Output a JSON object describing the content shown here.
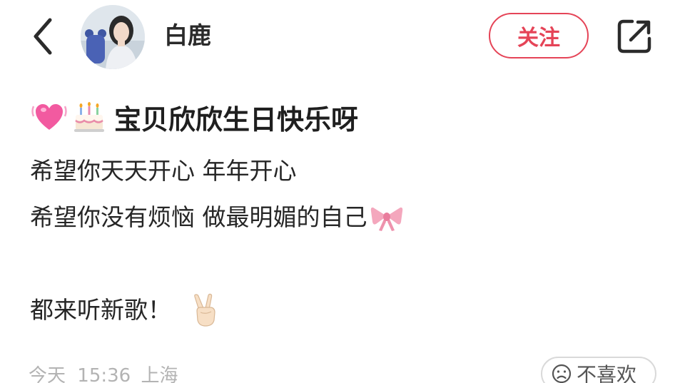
{
  "header": {
    "author_name": "白鹿",
    "follow_label": "关注"
  },
  "post": {
    "title": "宝贝欣欣生日快乐呀",
    "lines": [
      "希望你天天开心 年年开心",
      "希望你没有烦恼 做最明媚的自己",
      "都来听新歌！"
    ],
    "meta": {
      "date": "今天",
      "time": "15:36",
      "location": "上海"
    },
    "dislike_label": "不喜欢"
  },
  "icons": {
    "back": "back-chevron-icon",
    "share": "share-icon",
    "heart": "growing-heart-emoji",
    "cake": "birthday-cake-emoji",
    "ribbon": "ribbon-emoji",
    "victory": "victory-hand-emoji",
    "dislike": "frown-face-icon"
  },
  "colors": {
    "accent": "#e54457",
    "meta_text": "#b3b3b3"
  }
}
